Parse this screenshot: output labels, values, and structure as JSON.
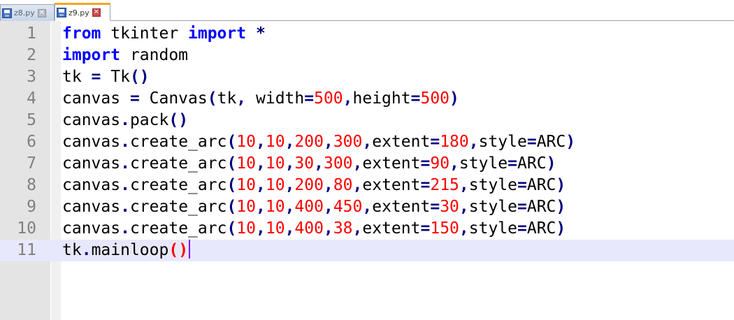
{
  "tabs": [
    {
      "label": "z8.py",
      "close": "✕",
      "active": false
    },
    {
      "label": "z9.py",
      "close": "✕",
      "active": true
    }
  ],
  "editor": {
    "current_line": 11,
    "lines": [
      {
        "n": "1",
        "tokens": [
          [
            "kw",
            "from"
          ],
          [
            "txt",
            " tkinter "
          ],
          [
            "kw",
            "import"
          ],
          [
            "txt",
            " "
          ],
          [
            "op",
            "*"
          ]
        ]
      },
      {
        "n": "2",
        "tokens": [
          [
            "kw",
            "import"
          ],
          [
            "txt",
            " random"
          ]
        ]
      },
      {
        "n": "3",
        "tokens": [
          [
            "txt",
            "tk "
          ],
          [
            "op",
            "="
          ],
          [
            "txt",
            " Tk"
          ],
          [
            "op",
            "()"
          ]
        ]
      },
      {
        "n": "4",
        "tokens": [
          [
            "txt",
            "canvas "
          ],
          [
            "op",
            "="
          ],
          [
            "txt",
            " Canvas"
          ],
          [
            "op",
            "("
          ],
          [
            "txt",
            "tk"
          ],
          [
            "op",
            ","
          ],
          [
            "txt",
            " width"
          ],
          [
            "op",
            "="
          ],
          [
            "num",
            "500"
          ],
          [
            "op",
            ","
          ],
          [
            "txt",
            "height"
          ],
          [
            "op",
            "="
          ],
          [
            "num",
            "500"
          ],
          [
            "op",
            ")"
          ]
        ]
      },
      {
        "n": "5",
        "tokens": [
          [
            "txt",
            "canvas"
          ],
          [
            "op",
            "."
          ],
          [
            "txt",
            "pack"
          ],
          [
            "op",
            "()"
          ]
        ]
      },
      {
        "n": "6",
        "tokens": [
          [
            "txt",
            "canvas"
          ],
          [
            "op",
            "."
          ],
          [
            "txt",
            "create_arc"
          ],
          [
            "op",
            "("
          ],
          [
            "num",
            "10"
          ],
          [
            "op",
            ","
          ],
          [
            "num",
            "10"
          ],
          [
            "op",
            ","
          ],
          [
            "num",
            "200"
          ],
          [
            "op",
            ","
          ],
          [
            "num",
            "300"
          ],
          [
            "op",
            ","
          ],
          [
            "txt",
            "extent"
          ],
          [
            "op",
            "="
          ],
          [
            "num",
            "180"
          ],
          [
            "op",
            ","
          ],
          [
            "txt",
            "style"
          ],
          [
            "op",
            "="
          ],
          [
            "txt",
            "ARC"
          ],
          [
            "op",
            ")"
          ]
        ]
      },
      {
        "n": "7",
        "tokens": [
          [
            "txt",
            "canvas"
          ],
          [
            "op",
            "."
          ],
          [
            "txt",
            "create_arc"
          ],
          [
            "op",
            "("
          ],
          [
            "num",
            "10"
          ],
          [
            "op",
            ","
          ],
          [
            "num",
            "10"
          ],
          [
            "op",
            ","
          ],
          [
            "num",
            "30"
          ],
          [
            "op",
            ","
          ],
          [
            "num",
            "300"
          ],
          [
            "op",
            ","
          ],
          [
            "txt",
            "extent"
          ],
          [
            "op",
            "="
          ],
          [
            "num",
            "90"
          ],
          [
            "op",
            ","
          ],
          [
            "txt",
            "style"
          ],
          [
            "op",
            "="
          ],
          [
            "txt",
            "ARC"
          ],
          [
            "op",
            ")"
          ]
        ]
      },
      {
        "n": "8",
        "tokens": [
          [
            "txt",
            "canvas"
          ],
          [
            "op",
            "."
          ],
          [
            "txt",
            "create_arc"
          ],
          [
            "op",
            "("
          ],
          [
            "num",
            "10"
          ],
          [
            "op",
            ","
          ],
          [
            "num",
            "10"
          ],
          [
            "op",
            ","
          ],
          [
            "num",
            "200"
          ],
          [
            "op",
            ","
          ],
          [
            "num",
            "80"
          ],
          [
            "op",
            ","
          ],
          [
            "txt",
            "extent"
          ],
          [
            "op",
            "="
          ],
          [
            "num",
            "215"
          ],
          [
            "op",
            ","
          ],
          [
            "txt",
            "style"
          ],
          [
            "op",
            "="
          ],
          [
            "txt",
            "ARC"
          ],
          [
            "op",
            ")"
          ]
        ]
      },
      {
        "n": "9",
        "tokens": [
          [
            "txt",
            "canvas"
          ],
          [
            "op",
            "."
          ],
          [
            "txt",
            "create_arc"
          ],
          [
            "op",
            "("
          ],
          [
            "num",
            "10"
          ],
          [
            "op",
            ","
          ],
          [
            "num",
            "10"
          ],
          [
            "op",
            ","
          ],
          [
            "num",
            "400"
          ],
          [
            "op",
            ","
          ],
          [
            "num",
            "450"
          ],
          [
            "op",
            ","
          ],
          [
            "txt",
            "extent"
          ],
          [
            "op",
            "="
          ],
          [
            "num",
            "30"
          ],
          [
            "op",
            ","
          ],
          [
            "txt",
            "style"
          ],
          [
            "op",
            "="
          ],
          [
            "txt",
            "ARC"
          ],
          [
            "op",
            ")"
          ]
        ]
      },
      {
        "n": "10",
        "tokens": [
          [
            "txt",
            "canvas"
          ],
          [
            "op",
            "."
          ],
          [
            "txt",
            "create_arc"
          ],
          [
            "op",
            "("
          ],
          [
            "num",
            "10"
          ],
          [
            "op",
            ","
          ],
          [
            "num",
            "10"
          ],
          [
            "op",
            ","
          ],
          [
            "num",
            "400"
          ],
          [
            "op",
            ","
          ],
          [
            "num",
            "38"
          ],
          [
            "op",
            ","
          ],
          [
            "txt",
            "extent"
          ],
          [
            "op",
            "="
          ],
          [
            "num",
            "150"
          ],
          [
            "op",
            ","
          ],
          [
            "txt",
            "style"
          ],
          [
            "op",
            "="
          ],
          [
            "txt",
            "ARC"
          ],
          [
            "op",
            ")"
          ]
        ]
      },
      {
        "n": "11",
        "tokens": [
          [
            "txt",
            "tk"
          ],
          [
            "op",
            "."
          ],
          [
            "txt",
            "mainloop"
          ],
          [
            "brace-hl",
            "()"
          ]
        ]
      }
    ]
  },
  "colors": {
    "keyword": "#0000ff",
    "operator": "#000080",
    "number": "#ff0000",
    "brace_highlight": "#ff0000",
    "current_line_bg": "#e8e8fc",
    "active_tab_accent": "#f5a623",
    "caret": "#8000ff"
  }
}
